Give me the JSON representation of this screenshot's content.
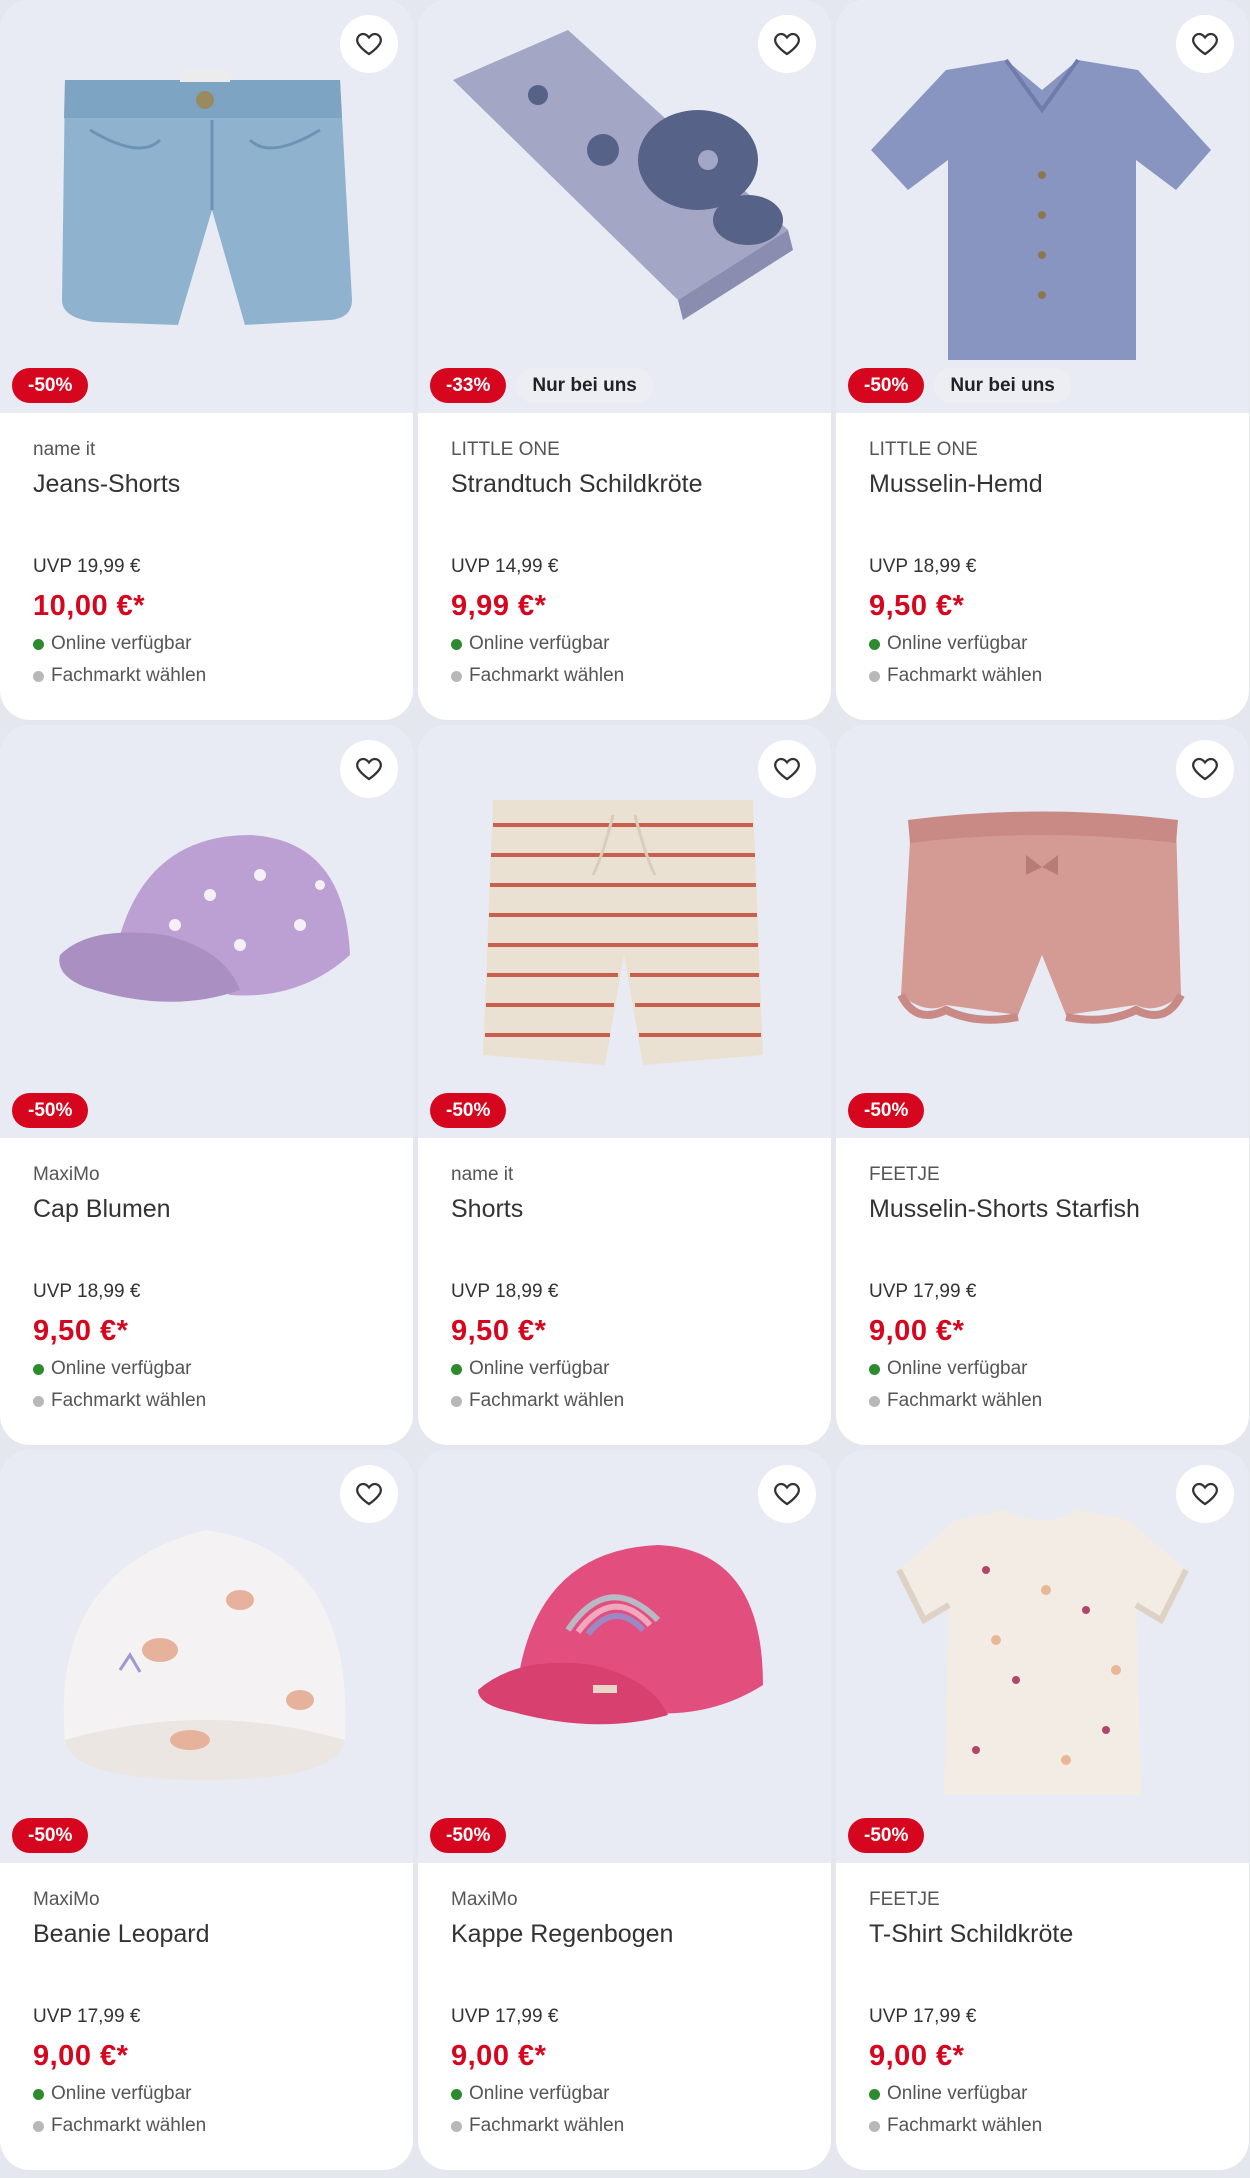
{
  "colors": {
    "sale": "#d6061e",
    "online": "#2e8a2e",
    "store": "#b8b8b8"
  },
  "products": [
    {
      "brand": "name it",
      "title": "Jeans-Shorts",
      "uvp": "UVP 19,99 €",
      "price": "10,00 €*",
      "discount": "-50%",
      "exclusive": "",
      "online": "Online verfügbar",
      "store": "Fachmarkt wählen",
      "image": "jeans-shorts"
    },
    {
      "brand": "LITTLE ONE",
      "title": "Strandtuch Schildkröte",
      "uvp": "UVP 14,99 €",
      "price": "9,99 €*",
      "discount": "-33%",
      "exclusive": "Nur bei uns",
      "online": "Online verfügbar",
      "store": "Fachmarkt wählen",
      "image": "beach-towel"
    },
    {
      "brand": "LITTLE ONE",
      "title": "Musselin-Hemd",
      "uvp": "UVP 18,99 €",
      "price": "9,50 €*",
      "discount": "-50%",
      "exclusive": "Nur bei uns",
      "online": "Online verfügbar",
      "store": "Fachmarkt wählen",
      "image": "muslin-shirt"
    },
    {
      "brand": "MaxiMo",
      "title": "Cap Blumen",
      "uvp": "UVP 18,99 €",
      "price": "9,50 €*",
      "discount": "-50%",
      "exclusive": "",
      "online": "Online verfügbar",
      "store": "Fachmarkt wählen",
      "image": "cap-flowers"
    },
    {
      "brand": "name it",
      "title": "Shorts",
      "uvp": "UVP 18,99 €",
      "price": "9,50 €*",
      "discount": "-50%",
      "exclusive": "",
      "online": "Online verfügbar",
      "store": "Fachmarkt wählen",
      "image": "striped-shorts"
    },
    {
      "brand": "FEETJE",
      "title": "Musselin-Shorts Starfish",
      "uvp": "UVP 17,99 €",
      "price": "9,00 €*",
      "discount": "-50%",
      "exclusive": "",
      "online": "Online verfügbar",
      "store": "Fachmarkt wählen",
      "image": "pink-shorts"
    },
    {
      "brand": "MaxiMo",
      "title": "Beanie Leopard",
      "uvp": "UVP 17,99 €",
      "price": "9,00 €*",
      "discount": "-50%",
      "exclusive": "",
      "online": "Online verfügbar",
      "store": "Fachmarkt wählen",
      "image": "beanie"
    },
    {
      "brand": "MaxiMo",
      "title": "Kappe Regenbogen",
      "uvp": "UVP 17,99 €",
      "price": "9,00 €*",
      "discount": "-50%",
      "exclusive": "",
      "online": "Online verfügbar",
      "store": "Fachmarkt wählen",
      "image": "cap-rainbow"
    },
    {
      "brand": "FEETJE",
      "title": "T-Shirt Schildkröte",
      "uvp": "UVP 17,99 €",
      "price": "9,00 €*",
      "discount": "-50%",
      "exclusive": "",
      "online": "Online verfügbar",
      "store": "Fachmarkt wählen",
      "image": "tshirt"
    }
  ]
}
